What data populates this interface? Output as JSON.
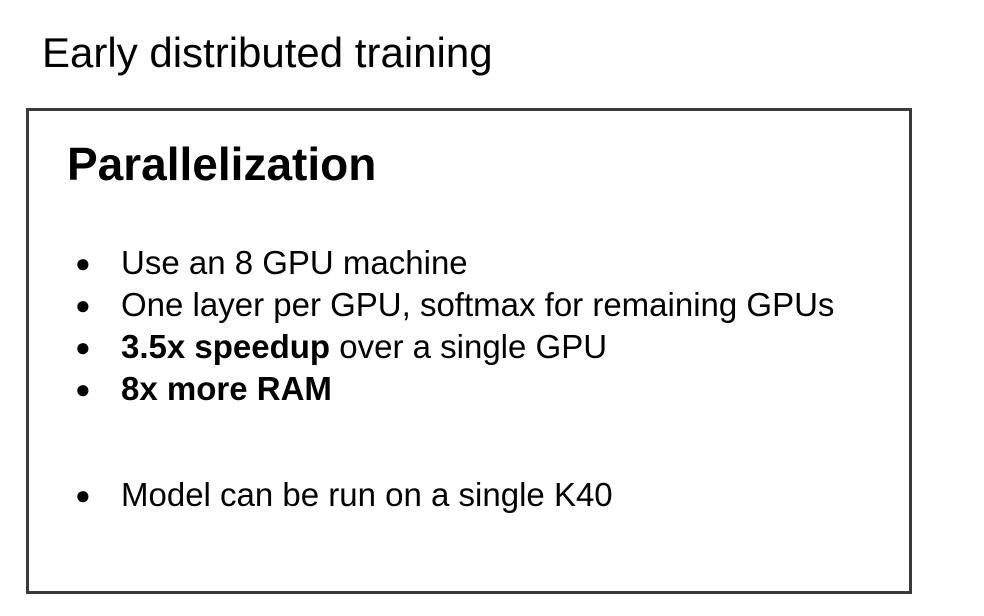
{
  "slide": {
    "title": "Early distributed training"
  },
  "box": {
    "heading": "Parallelization",
    "bullets": [
      {
        "bold": "",
        "text": "Use an 8 GPU machine"
      },
      {
        "bold": "",
        "text": "One layer per GPU, softmax for remaining GPUs"
      },
      {
        "bold": "3.5x speedup",
        "text": " over a single GPU"
      },
      {
        "bold": "8x more RAM",
        "text": ""
      }
    ],
    "bullets_after_gap": [
      {
        "bold": "",
        "text": "Model can be run on a single K40"
      }
    ],
    "bullet_symbol": "●"
  }
}
